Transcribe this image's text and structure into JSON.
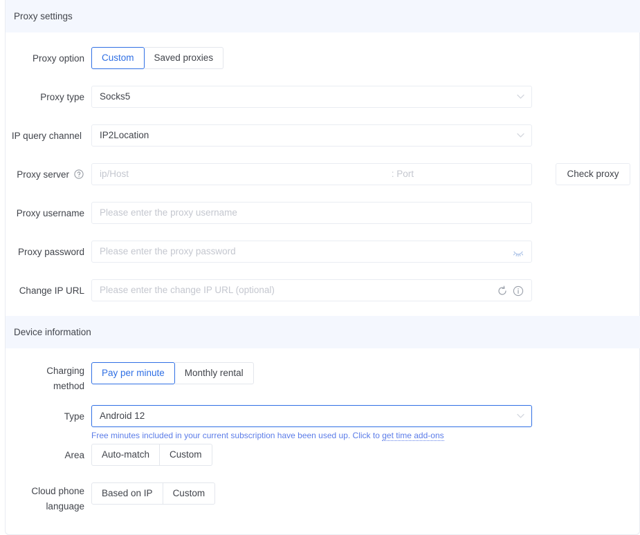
{
  "sections": {
    "proxy": {
      "title": "Proxy settings",
      "rows": {
        "proxy_option": {
          "label": "Proxy option",
          "options": [
            "Custom",
            "Saved proxies"
          ],
          "selected": "Custom"
        },
        "proxy_type": {
          "label": "Proxy type",
          "value": "Socks5",
          "icon": "chevron-down-icon"
        },
        "ip_query_channel": {
          "label": "IP query channel",
          "value": "IP2Location",
          "icon": "chevron-down-icon"
        },
        "proxy_server": {
          "label": "Proxy server",
          "help_icon": "question-circle-icon",
          "host_placeholder": "ip/Host",
          "port_placeholder": ": Port",
          "check_button": "Check proxy"
        },
        "proxy_username": {
          "label": "Proxy username",
          "placeholder": "Please enter the proxy username"
        },
        "proxy_password": {
          "label": "Proxy password",
          "placeholder": "Please enter the proxy password",
          "icon": "eye-off-icon"
        },
        "change_ip_url": {
          "label": "Change IP URL",
          "placeholder": "Please enter the change IP URL (optional)",
          "icon_refresh": "refresh-icon",
          "icon_info": "info-circle-icon"
        }
      }
    },
    "device": {
      "title": "Device information",
      "rows": {
        "charging_method": {
          "label_line1": "Charging",
          "label_line2": "method",
          "options": [
            "Pay per minute",
            "Monthly rental"
          ],
          "selected": "Pay per minute"
        },
        "type": {
          "label": "Type",
          "value": "Android 12",
          "icon": "chevron-down-icon",
          "hint_text": "Free minutes included in your current subscription have been used up. Click to ",
          "hint_link": "get time add-ons"
        },
        "area": {
          "label": "Area",
          "options": [
            "Auto-match",
            "Custom"
          ],
          "selected": ""
        },
        "cloud_phone_language": {
          "label_line1": "Cloud phone",
          "label_line2": "language",
          "options": [
            "Based on IP",
            "Custom"
          ],
          "selected": ""
        }
      }
    }
  },
  "colors": {
    "accent": "#2f6fe4",
    "header_bg": "#f4f7fe",
    "hint": "#5b7ce8",
    "border": "#e9ecf2",
    "placeholder": "#c4c7cf"
  }
}
